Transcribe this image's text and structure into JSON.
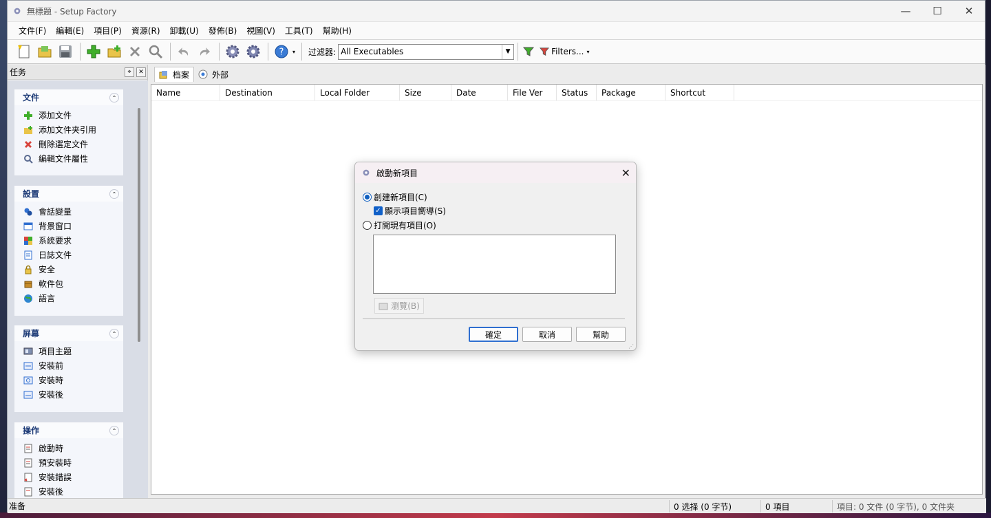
{
  "window": {
    "title": "無標題 - Setup Factory"
  },
  "menu": [
    "文件(F)",
    "編輯(E)",
    "項目(P)",
    "資源(R)",
    "卸載(U)",
    "發佈(B)",
    "視圖(V)",
    "工具(T)",
    "幫助(H)"
  ],
  "toolbar": {
    "filter_label": "过滤器:",
    "filter_value": "All Executables",
    "filters_button": "Filters..."
  },
  "sidebar": {
    "title": "任务",
    "groups": [
      {
        "title": "文件",
        "items": [
          "添加文件",
          "添加文件夹引用",
          "刪除選定文件",
          "編輯文件屬性"
        ]
      },
      {
        "title": "設置",
        "items": [
          "會話變量",
          "背景窗口",
          "系統要求",
          "日誌文件",
          "安全",
          "軟件包",
          "語言"
        ]
      },
      {
        "title": "屏幕",
        "items": [
          "項目主題",
          "安裝前",
          "安裝時",
          "安裝後"
        ]
      },
      {
        "title": "操作",
        "items": [
          "啟動時",
          "預安裝時",
          "安裝錯誤",
          "安裝後"
        ]
      }
    ]
  },
  "tabs": [
    "档案",
    "外部"
  ],
  "columns": [
    "Name",
    "Destination",
    "Local Folder",
    "Size",
    "Date",
    "File Ver",
    "Status",
    "Package",
    "Shortcut"
  ],
  "status": {
    "ready": "准备",
    "selection": "0 选择 (0 字节)",
    "items": "0 項目",
    "project": "項目: 0 文件 (0 字节), 0 文件夹"
  },
  "dialog": {
    "title": "啟動新項目",
    "option_new": "創建新項目(C)",
    "option_wizard": "顯示項目嚮導(S)",
    "option_open": "打開現有項目(O)",
    "browse": "瀏覽(B)",
    "ok": "確定",
    "cancel": "取消",
    "help": "幫助"
  }
}
